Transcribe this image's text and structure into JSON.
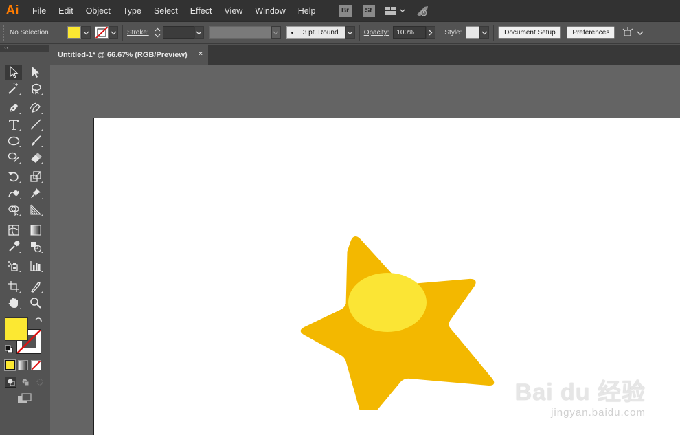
{
  "app": {
    "logo": "Ai"
  },
  "menu": {
    "items": [
      "File",
      "Edit",
      "Object",
      "Type",
      "Select",
      "Effect",
      "View",
      "Window",
      "Help"
    ],
    "bridge_label": "Br",
    "stock_label": "St"
  },
  "control_bar": {
    "selection_status": "No Selection",
    "fill_color": "#fce832",
    "stroke_label": "Stroke:",
    "brush_value": "3 pt. Round",
    "opacity_label": "Opacity:",
    "opacity_value": "100%",
    "style_label": "Style:",
    "document_setup_label": "Document Setup",
    "preferences_label": "Preferences"
  },
  "document": {
    "tab_title": "Untitled-1* @ 66.67% (RGB/Preview)",
    "close_glyph": "×"
  },
  "tools": [
    "selection-tool",
    "direct-selection-tool",
    "magic-wand-tool",
    "lasso-tool",
    "pen-tool",
    "curvature-tool",
    "type-tool",
    "line-segment-tool",
    "ellipse-tool",
    "paintbrush-tool",
    "shaper-tool",
    "eraser-tool",
    "rotate-tool",
    "scale-tool",
    "warp-tool",
    "puppet-warp-tool",
    "shape-builder-tool",
    "perspective-grid-tool",
    "mesh-tool",
    "gradient-tool",
    "eyedropper-tool",
    "blend-tool",
    "symbol-sprayer-tool",
    "column-graph-tool",
    "artboard-tool",
    "slice-tool",
    "hand-tool",
    "zoom-tool"
  ],
  "swatches": {
    "fill_color": "#fce832",
    "stroke_color": "none"
  },
  "artwork": {
    "star_color": "#f3b800",
    "highlight_color": "#fbe535"
  },
  "watermark": {
    "brand": "Bai du 经验",
    "url": "jingyan.baidu.com"
  }
}
